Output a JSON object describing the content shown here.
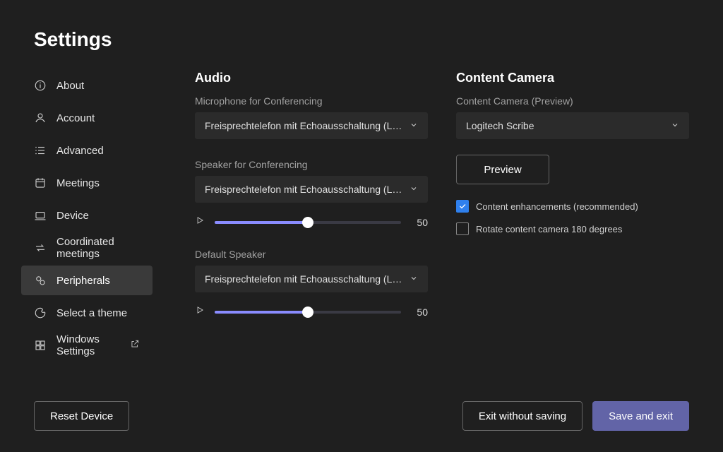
{
  "title": "Settings",
  "sidebar": {
    "items": [
      {
        "label": "About"
      },
      {
        "label": "Account"
      },
      {
        "label": "Advanced"
      },
      {
        "label": "Meetings"
      },
      {
        "label": "Device"
      },
      {
        "label": "Coordinated meetings"
      },
      {
        "label": "Peripherals"
      },
      {
        "label": "Select a theme"
      },
      {
        "label": "Windows Settings"
      }
    ],
    "selected_index": 6
  },
  "audio": {
    "heading": "Audio",
    "microphone": {
      "label": "Microphone for Conferencing",
      "value": "Freisprechtelefon mit Echoausschaltung (Log…"
    },
    "speaker": {
      "label": "Speaker for Conferencing",
      "value": "Freisprechtelefon mit Echoausschaltung (Log…",
      "level": 50
    },
    "default_speaker": {
      "label": "Default Speaker",
      "value": "Freisprechtelefon mit Echoausschaltung (Log…",
      "level": 50
    }
  },
  "camera": {
    "heading": "Content Camera",
    "label": "Content Camera (Preview)",
    "value": "Logitech Scribe",
    "preview_button": "Preview",
    "enhancements": {
      "label": "Content enhancements (recommended)",
      "checked": true
    },
    "rotate": {
      "label": "Rotate content camera 180 degrees",
      "checked": false
    }
  },
  "footer": {
    "reset": "Reset Device",
    "exit": "Exit without saving",
    "save": "Save and exit"
  }
}
